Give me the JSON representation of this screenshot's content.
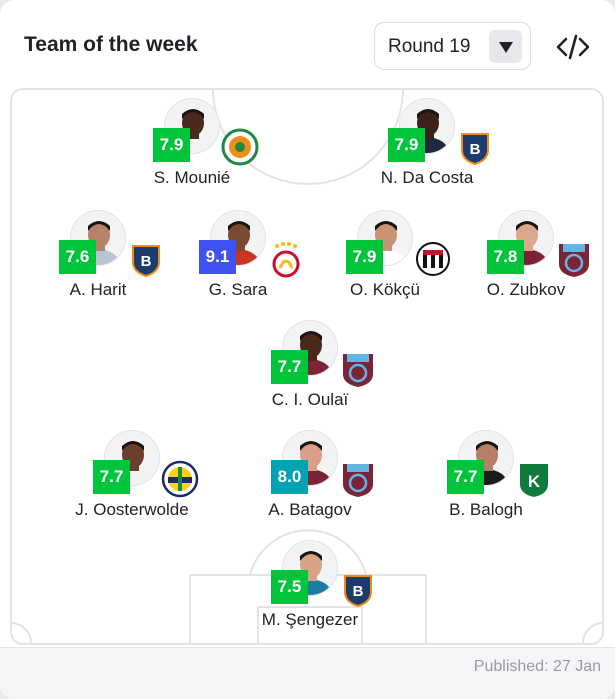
{
  "header": {
    "title": "Team of the week",
    "round_label": "Round 19",
    "embed_icon": "code-icon"
  },
  "colors": {
    "rating_green": "#00c43a",
    "rating_teal": "#00a2b3",
    "rating_blue": "#3f51ee",
    "pitch_lines": "#e3e3e7"
  },
  "players": [
    {
      "name": "S. Mounié",
      "rating": "7.9",
      "rating_color": "#00c43a",
      "skin": "#4a2a1c",
      "shirt": "#f3f3f3",
      "club": "alanyaspor-badge"
    },
    {
      "name": "N. Da Costa",
      "rating": "7.9",
      "rating_color": "#00c43a",
      "skin": "#3b2218",
      "shirt": "#1d2a40",
      "club": "basaksehir-badge"
    },
    {
      "name": "A. Harit",
      "rating": "7.6",
      "rating_color": "#00c43a",
      "skin": "#b5826a",
      "shirt": "#b7c4d4",
      "club": "basaksehir-badge"
    },
    {
      "name": "G. Sara",
      "rating": "9.1",
      "rating_color": "#3f51ee",
      "skin": "#7a4a32",
      "shirt": "#c7371f",
      "club": "galatasaray-badge"
    },
    {
      "name": "O. Kökçü",
      "rating": "7.9",
      "rating_color": "#00c43a",
      "skin": "#c79275",
      "shirt": "#ffffff",
      "club": "besiktas-badge"
    },
    {
      "name": "O. Zubkov",
      "rating": "7.8",
      "rating_color": "#00c43a",
      "skin": "#dba88e",
      "shirt": "#7a2436",
      "club": "trabzonspor-badge"
    },
    {
      "name": "C. I. Oulaï",
      "rating": "7.7",
      "rating_color": "#00c43a",
      "skin": "#4a2a1c",
      "shirt": "#7a2436",
      "club": "trabzonspor-badge"
    },
    {
      "name": "J. Oosterwolde",
      "rating": "7.7",
      "rating_color": "#00c43a",
      "skin": "#6b3f2a",
      "shirt": "#f2f2f2",
      "club": "fenerbahce-badge"
    },
    {
      "name": "A. Batagov",
      "rating": "8.0",
      "rating_color": "#00a2b3",
      "skin": "#d9a087",
      "shirt": "#7a2436",
      "club": "trabzonspor-badge"
    },
    {
      "name": "B. Balogh",
      "rating": "7.7",
      "rating_color": "#00c43a",
      "skin": "#b58066",
      "shirt": "#1b1b1b",
      "club": "kocaelispor-badge"
    },
    {
      "name": "M. Şengezer",
      "rating": "7.5",
      "rating_color": "#00c43a",
      "skin": "#d7a387",
      "shirt": "#1c7da0",
      "club": "basaksehir-badge"
    }
  ],
  "footer": {
    "published": "Published: 27 Jan"
  }
}
